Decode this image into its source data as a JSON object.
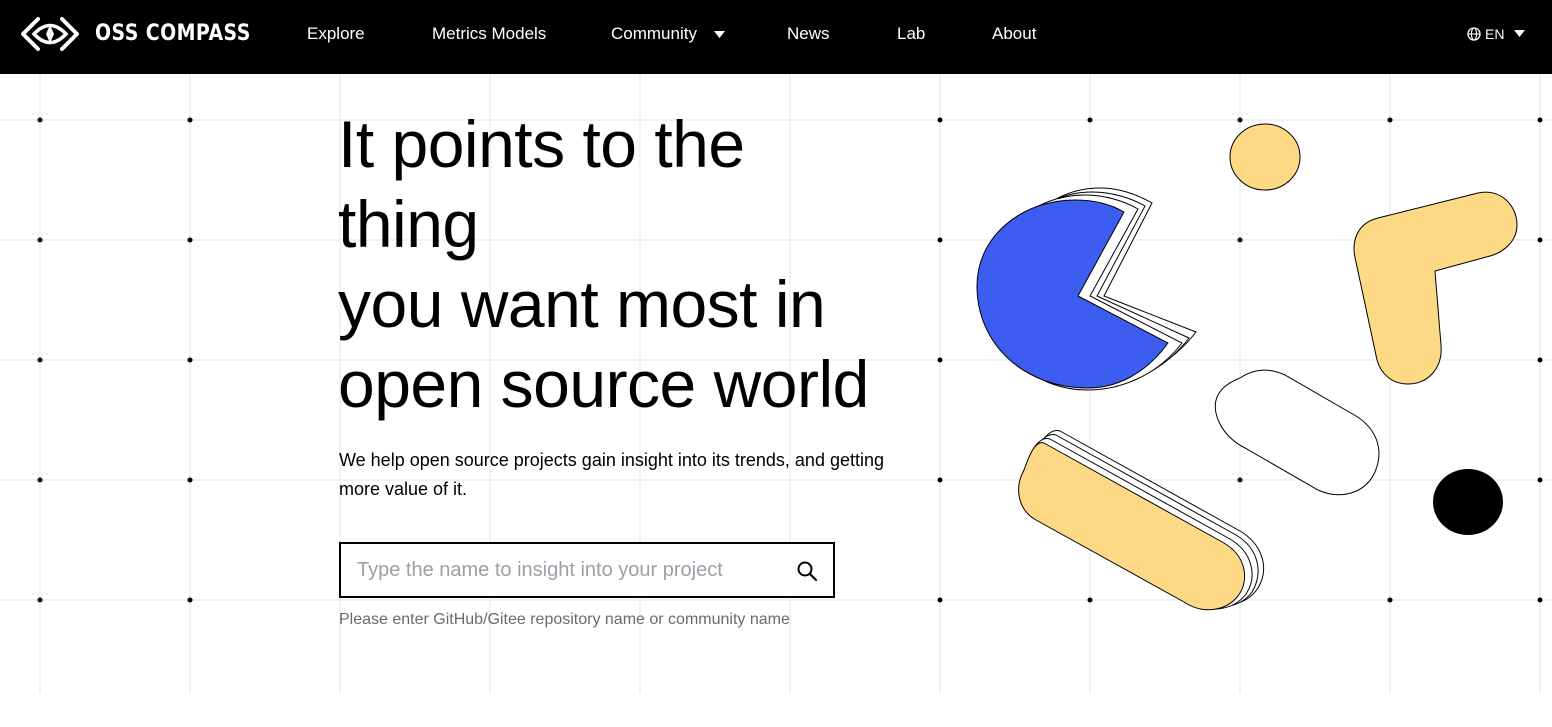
{
  "nav": {
    "brand": "OSS COMPASS",
    "items": [
      {
        "label": "Explore"
      },
      {
        "label": "Metrics Models"
      },
      {
        "label": "Community",
        "has_dropdown": true
      },
      {
        "label": "News"
      },
      {
        "label": "Lab"
      },
      {
        "label": "About"
      }
    ],
    "language": "EN"
  },
  "hero": {
    "headline_lines": [
      "It points to the",
      "thing",
      "you want most in",
      "open source world"
    ],
    "subtitle": "We help open source projects gain insight into its trends, and getting more value of it.",
    "search": {
      "placeholder": "Type the name to insight into your project",
      "value": ""
    },
    "hint": "Please enter GitHub/Gitee repository name or community name"
  },
  "icons": {
    "logo": "compass-eye-logo-icon",
    "dropdown": "caret-down-icon",
    "language": "globe-icon",
    "search": "search-icon"
  },
  "colors": {
    "nav_bg": "#000000",
    "accent_blue": "#3d5cf0",
    "accent_yellow": "#fdd985",
    "text": "#000000",
    "hint": "#6b6b6b"
  }
}
